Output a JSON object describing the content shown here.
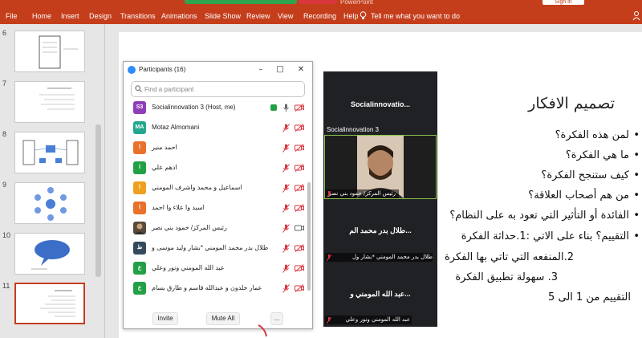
{
  "ribbon": {
    "tabs": [
      "File",
      "Home",
      "Insert",
      "Design",
      "Transitions",
      "Animations",
      "Slide Show",
      "Review",
      "View",
      "Recording",
      "Help"
    ],
    "tell_me": "Tell me what you want to do",
    "sign_in": "Sign in",
    "title_fragment": "PowerPoint"
  },
  "thumbnails": {
    "numbers": [
      "6",
      "7",
      "8",
      "9",
      "10",
      "11"
    ],
    "selected": "11"
  },
  "slide": {
    "title": "تصميم الافكار",
    "bullets": [
      "لمن هذه الفكرة؟",
      "ما هي الفكرة؟",
      "كيف ستنجح الفكرة؟",
      "من هم أصحاب العلاقة؟",
      "الفائدة أو التأثير التي تعود به على النظام؟",
      "التقييم؟ بناء على الاتي :1.حداثة الفكرة"
    ],
    "numbered": [
      "2.المنفعه التي تاتي بها الفكرة",
      "3. سهولة تطبيق الفكرة"
    ],
    "footer_line": "التقييم من 1 الى 5"
  },
  "participants": {
    "title": "Participants (16)",
    "search_placeholder": "Find a participant",
    "list": [
      {
        "initials": "S3",
        "color": "#8e3fb8",
        "name": "Socialinnovation 3 (Host, me)",
        "muted": false,
        "share": true
      },
      {
        "initials": "MA",
        "color": "#23a88e",
        "name": "Motaz Almomani",
        "muted": true,
        "share": false
      },
      {
        "initials": "ا",
        "color": "#e8712c",
        "name": "احمد منير",
        "muted": true,
        "share": false
      },
      {
        "initials": "ا",
        "color": "#23a046",
        "name": "ادهم علي",
        "muted": true,
        "share": false
      },
      {
        "initials": "ا",
        "color": "#f0a020",
        "name": "اسماعيل و محمد واشرف المومني",
        "muted": true,
        "share": false
      },
      {
        "initials": "ا",
        "color": "#e8712c",
        "name": "اسيد وا علاء وا احمد",
        "muted": true,
        "share": false
      },
      {
        "initials": "",
        "color": "#5a4a3a",
        "name": "رئيس المركز/ حمود بني نصر",
        "muted": true,
        "share": false
      },
      {
        "initials": "ط",
        "color": "#34495e",
        "name": "طلال بدر محمد المومني *بشار وليد موسى و",
        "muted": true,
        "share": false
      },
      {
        "initials": "ع",
        "color": "#23a046",
        "name": "عبد الله المومني ونور وعلي",
        "muted": true,
        "share": false
      },
      {
        "initials": "ع",
        "color": "#23a046",
        "name": "عمار خلدون و عبدالله قاسم و طارق بسام",
        "muted": true,
        "share": false
      }
    ],
    "invite": "Invite",
    "mute_all": "Mute All",
    "more": "..."
  },
  "video": {
    "tile1_name": "Socialinnovatio...",
    "tile1_label": "Socialinnovation 3",
    "tile2_caption": "رئيس المركز/ حمود بني نصر",
    "tile3_name": "طلال بدر محمد الم...",
    "tile3_caption": "طلال بدر محمد المومني *بشار ول",
    "tile4_name": "عبد الله المومني و...",
    "tile4_caption": "عبد الله المومني ونور وعلي"
  },
  "colors": {
    "accent": "#c43e1c",
    "zoom_blue": "#2d8cff",
    "muted_red": "#d9363e"
  }
}
